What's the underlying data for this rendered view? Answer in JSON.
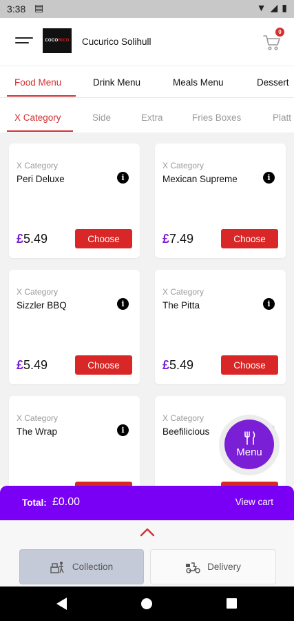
{
  "status_bar": {
    "time": "3:38",
    "left_icon": "notification-icon",
    "right_icons": [
      "wifi-icon",
      "signal-icon",
      "battery-icon"
    ]
  },
  "header": {
    "logo_text": "COCO",
    "logo_text_accent": "RICO",
    "store_name": "Cucurico Solihull",
    "cart_count": "0"
  },
  "menu_tabs": [
    {
      "label": "Food Menu",
      "active": true
    },
    {
      "label": "Drink Menu",
      "active": false
    },
    {
      "label": "Meals Menu",
      "active": false
    },
    {
      "label": "Dessert",
      "active": false
    }
  ],
  "category_tabs": [
    {
      "label": "X Category",
      "active": true
    },
    {
      "label": "Side",
      "active": false
    },
    {
      "label": "Extra",
      "active": false
    },
    {
      "label": "Fries Boxes",
      "active": false
    },
    {
      "label": "Platt",
      "active": false
    }
  ],
  "products": [
    {
      "category": "X Category",
      "name": "Peri Deluxe",
      "currency": "£",
      "price": "5.49",
      "button": "Choose"
    },
    {
      "category": "X Category",
      "name": "Mexican Supreme",
      "currency": "£",
      "price": "7.49",
      "button": "Choose"
    },
    {
      "category": "X Category",
      "name": "Sizzler BBQ",
      "currency": "£",
      "price": "5.49",
      "button": "Choose"
    },
    {
      "category": "X Category",
      "name": "The Pitta",
      "currency": "£",
      "price": "5.49",
      "button": "Choose"
    },
    {
      "category": "X Category",
      "name": "The Wrap",
      "currency": "£",
      "price": "",
      "button": ""
    },
    {
      "category": "X Category",
      "name": "Beefilicious",
      "currency": "£",
      "price": "",
      "button": ""
    }
  ],
  "info_glyph": "i",
  "menu_fab": {
    "label": "Menu",
    "icon": "cutlery-icon"
  },
  "cart_bar": {
    "total_label": "Total:",
    "total_value": "£0.00",
    "view_cart": "View cart"
  },
  "order_types": {
    "collection": "Collection",
    "delivery": "Delivery"
  },
  "colors": {
    "accent_red": "#d32f2f",
    "brand_purple": "#7a00f5",
    "fab_purple": "#7a1fd6",
    "collection_selected": "#c5cad8"
  }
}
